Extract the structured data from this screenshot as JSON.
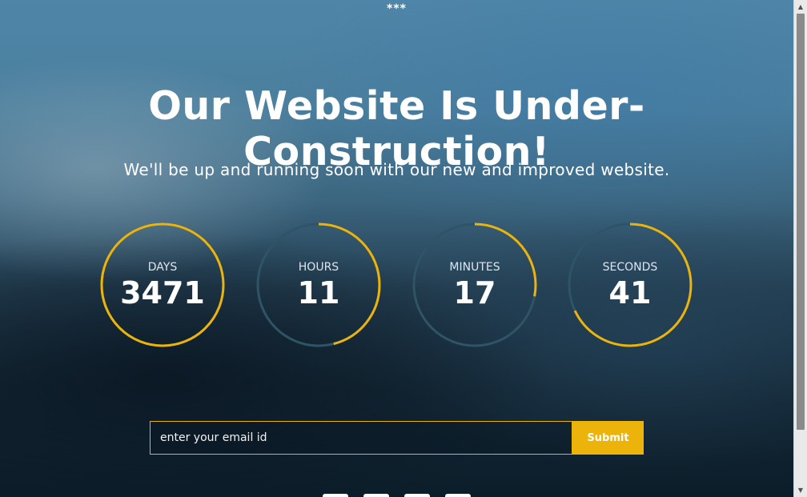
{
  "top_marker": "***",
  "title": "Our Website Is Under-Construction!",
  "subtitle": "We'll be up and running soon with our new and improved website.",
  "countdown": [
    {
      "label": "DAYS",
      "value": "3471",
      "progress": 1.0
    },
    {
      "label": "HOURS",
      "value": "11",
      "progress": 0.46
    },
    {
      "label": "MINUTES",
      "value": "17",
      "progress": 0.28
    },
    {
      "label": "SECONDS",
      "value": "41",
      "progress": 0.68
    }
  ],
  "subscribe": {
    "placeholder": "enter your email id",
    "submit_label": "Submit"
  },
  "colors": {
    "accent": "#ecb40b",
    "ring_track": "#2f5465",
    "text": "#ffffff"
  },
  "social_icons": [
    "social-icon-1",
    "social-icon-2",
    "social-icon-3",
    "social-icon-4"
  ],
  "scrollbar": {
    "up_icon": "scroll-up-icon",
    "down_icon": "scroll-down-icon"
  }
}
